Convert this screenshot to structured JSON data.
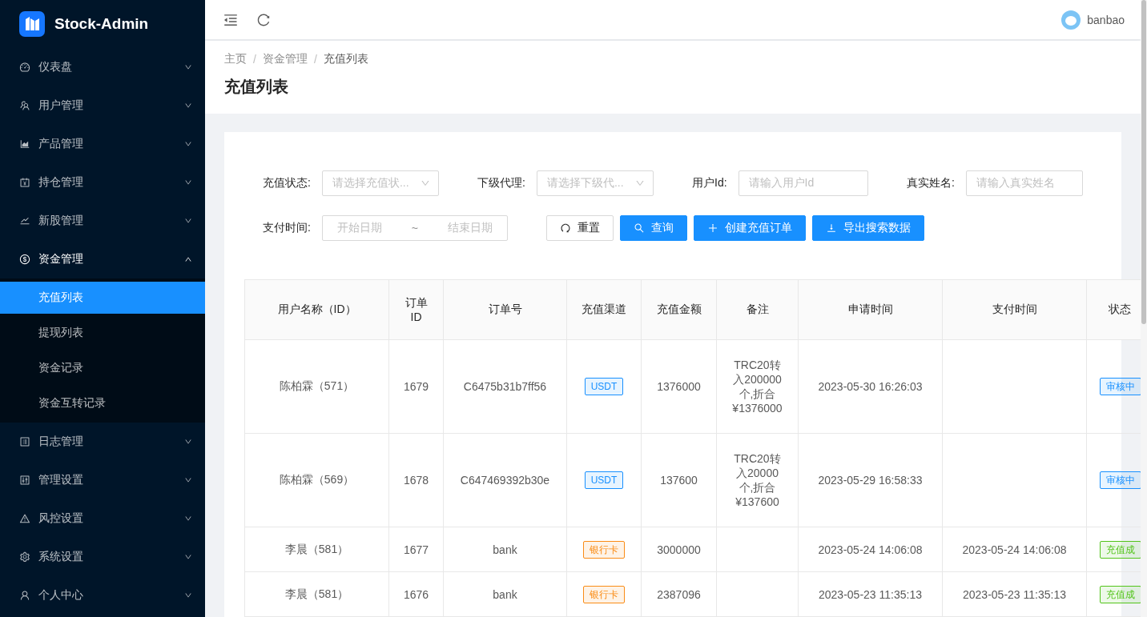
{
  "app": {
    "logo": "Stock-Admin"
  },
  "sidebar": {
    "items": [
      {
        "label": "仪表盘",
        "expanded": false
      },
      {
        "label": "用户管理",
        "expanded": false
      },
      {
        "label": "产品管理",
        "expanded": false
      },
      {
        "label": "持仓管理",
        "expanded": false
      },
      {
        "label": "新股管理",
        "expanded": false
      },
      {
        "label": "资金管理",
        "expanded": true,
        "children": [
          {
            "label": "充值列表",
            "selected": true
          },
          {
            "label": "提现列表",
            "selected": false
          },
          {
            "label": "资金记录",
            "selected": false
          },
          {
            "label": "资金互转记录",
            "selected": false
          }
        ]
      },
      {
        "label": "日志管理",
        "expanded": false
      },
      {
        "label": "管理设置",
        "expanded": false
      },
      {
        "label": "风控设置",
        "expanded": false
      },
      {
        "label": "系统设置",
        "expanded": false
      },
      {
        "label": "个人中心",
        "expanded": false
      }
    ]
  },
  "header": {
    "user": "banbao"
  },
  "breadcrumb": {
    "items": [
      "主页",
      "资金管理",
      "充值列表"
    ],
    "separator": "/"
  },
  "page_title": "充值列表",
  "filters": [
    {
      "kind": "select",
      "label": "充值状态:",
      "placeholder": "请选择充值状..."
    },
    {
      "kind": "select",
      "label": "下级代理:",
      "placeholder": "请选择下级代..."
    },
    {
      "kind": "input",
      "label": "用户Id:",
      "placeholder": "请输入用户Id"
    },
    {
      "kind": "input",
      "label": "真实姓名:",
      "placeholder": "请输入真实姓名"
    }
  ],
  "date_filter": {
    "label": "支付时间:",
    "start_placeholder": "开始日期",
    "separator": "~",
    "end_placeholder": "结束日期"
  },
  "buttons": [
    {
      "label": "重置",
      "kind": "default"
    },
    {
      "label": "查询",
      "kind": "primary"
    },
    {
      "label": "创建充值订单",
      "kind": "primary"
    },
    {
      "label": "导出搜索数据",
      "kind": "primary"
    }
  ],
  "table": {
    "columns": [
      "用户名称（ID）",
      "订单ID",
      "订单号",
      "充值渠道",
      "充值金额",
      "备注",
      "申请时间",
      "支付时间",
      "状态"
    ],
    "rows": [
      {
        "user": "陈柏霖（571）",
        "id": "1679",
        "order_no": "C6475b31b7ff56",
        "channel": {
          "text": "USDT",
          "color": "#1890ff"
        },
        "amount": "1376000",
        "note": "TRC20转入200000个,折合¥1376000",
        "apply_time": "2023-05-30 16:26:03",
        "status": {
          "text": "审核中",
          "color": "#1890ff"
        }
      },
      {
        "user": "陈柏霖（569）",
        "id": "1678",
        "order_no": "C647469392b30e",
        "channel": {
          "text": "USDT",
          "color": "#1890ff"
        },
        "amount": "137600",
        "note": "TRC20转入20000个,折合¥137600",
        "apply_time": "2023-05-29 16:58:33",
        "status": {
          "text": "审核中",
          "color": "#1890ff"
        }
      },
      {
        "user": "李晨（581）",
        "id": "1677",
        "order_no": "bank",
        "channel": {
          "text": "银行卡",
          "color": "#fa8c16"
        },
        "amount": "3000000",
        "apply_time": "2023-05-24 14:06:08",
        "pay_time": "2023-05-24 14:06:08",
        "status": {
          "text": "充值成",
          "color": "#52c41a"
        }
      },
      {
        "user": "李晨（581）",
        "id": "1676",
        "order_no": "bank",
        "channel": {
          "text": "银行卡",
          "color": "#fa8c16"
        },
        "amount": "2387096",
        "apply_time": "2023-05-23 11:35:13",
        "pay_time": "2023-05-23 11:35:13",
        "status": {
          "text": "充值成",
          "color": "#52c41a"
        }
      }
    ]
  }
}
